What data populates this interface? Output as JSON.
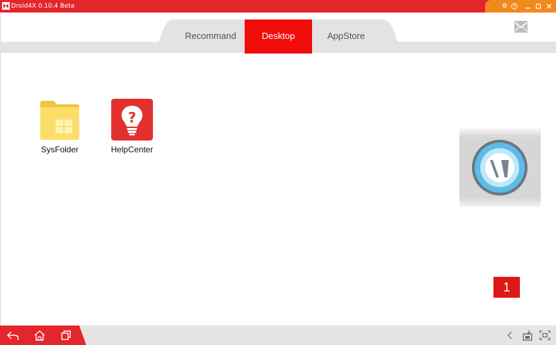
{
  "window": {
    "title": "Droid4X 0.10.4 Beta",
    "controls": [
      "settings-icon",
      "help-icon",
      "minimize-icon",
      "maximize-icon",
      "close-icon"
    ]
  },
  "tabs": [
    {
      "label": "Recommand",
      "selected": false
    },
    {
      "label": "Desktop",
      "selected": true
    },
    {
      "label": "AppStore",
      "selected": false
    }
  ],
  "desktop": {
    "icons": [
      {
        "label": "SysFolder",
        "icon": "folder-icon"
      },
      {
        "label": "HelpCenter",
        "icon": "lightbulb-help-icon"
      }
    ],
    "page_indicator": "1"
  },
  "bottom_nav": {
    "left": [
      "back-icon",
      "home-icon",
      "recent-apps-icon"
    ],
    "right": [
      "collapse-chevron-icon",
      "apk-install-icon",
      "fullscreen-icon"
    ]
  },
  "colors": {
    "title_bar": "#e2262c",
    "window_controls": "#f08a1c",
    "tab_selected": "#f20d0d",
    "badge": "#e01717"
  }
}
